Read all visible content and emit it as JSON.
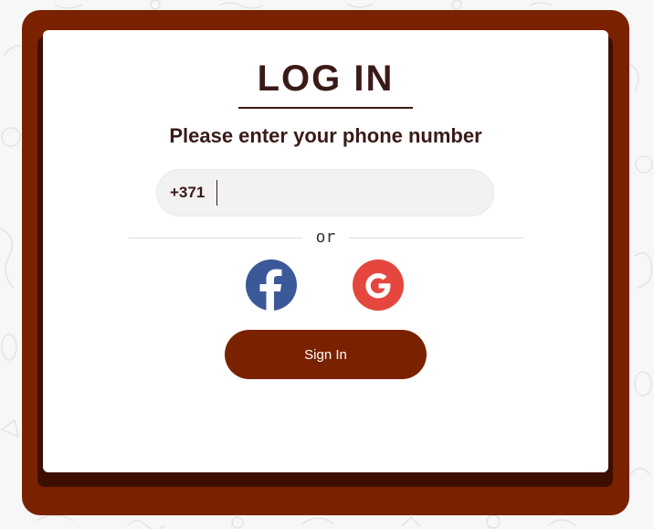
{
  "login": {
    "title": "LOG IN",
    "subtitle": "Please enter your phone number",
    "phone": {
      "prefix": "+371",
      "value": "",
      "placeholder": ""
    },
    "divider_text": "or",
    "social": {
      "facebook_icon": "facebook-icon",
      "google_icon": "google-icon"
    },
    "signin_label": "Sign In"
  },
  "colors": {
    "frame": "#7a2200",
    "frame_dark": "#3d0f02",
    "text": "#3a1a17",
    "facebook": "#3b5998",
    "google": "#e5473e"
  }
}
